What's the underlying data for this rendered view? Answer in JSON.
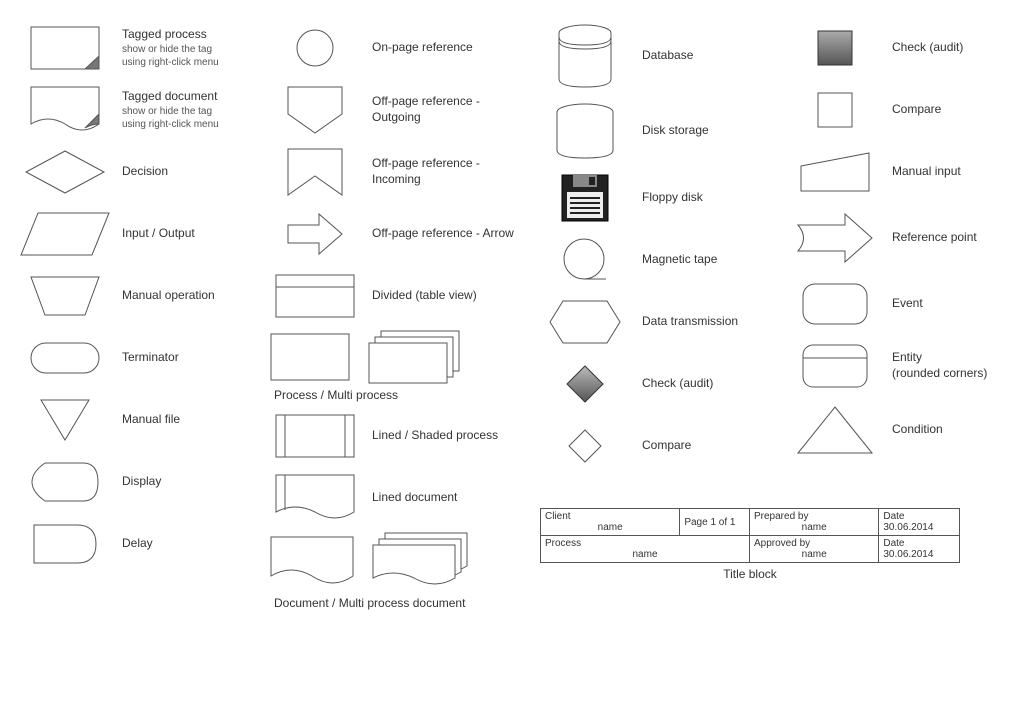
{
  "col1": {
    "tagged_process": {
      "label": "Tagged process",
      "sub1": "show or hide the tag",
      "sub2": "using right-click menu"
    },
    "tagged_document": {
      "label": "Tagged document",
      "sub1": "show or hide the tag",
      "sub2": "using right-click menu"
    },
    "decision": {
      "label": "Decision"
    },
    "input_output": {
      "label": "Input / Output"
    },
    "manual_operation": {
      "label": "Manual operation"
    },
    "terminator": {
      "label": "Terminator"
    },
    "manual_file": {
      "label": "Manual file"
    },
    "display": {
      "label": "Display"
    },
    "delay": {
      "label": "Delay"
    }
  },
  "col2": {
    "onpage": {
      "label": "On-page reference"
    },
    "offpage_out": {
      "label": "Off-page reference - Outgoing"
    },
    "offpage_in": {
      "label": "Off-page reference - Incoming"
    },
    "offpage_arrow": {
      "label": "Off-page reference - Arrow"
    },
    "divided": {
      "label": "Divided (table view)"
    },
    "process_multi": {
      "label": "Process / Multi process"
    },
    "lined_shaded": {
      "label": "Lined / Shaded process"
    },
    "lined_doc": {
      "label": "Lined document"
    },
    "doc_multi": {
      "label": "Document / Multi process document"
    }
  },
  "col3": {
    "database": {
      "label": "Database"
    },
    "disk_storage": {
      "label": "Disk storage"
    },
    "floppy": {
      "label": "Floppy disk"
    },
    "magnetic_tape": {
      "label": "Magnetic tape"
    },
    "data_trans": {
      "label": "Data transmission"
    },
    "check_audit": {
      "label": "Check (audit)"
    },
    "compare": {
      "label": "Compare"
    }
  },
  "col4": {
    "check_audit": {
      "label": "Check (audit)"
    },
    "compare": {
      "label": "Compare"
    },
    "manual_input": {
      "label": "Manual input"
    },
    "reference_point": {
      "label": "Reference point"
    },
    "event": {
      "label": "Event"
    },
    "entity": {
      "label": "Entity",
      "sub": "(rounded corners)"
    },
    "condition": {
      "label": "Condition"
    }
  },
  "title_block": {
    "client_lbl": "Client",
    "client_val": "name",
    "page_lbl": "Page 1  of  1",
    "prepared_lbl": "Prepared by",
    "prepared_val": "name",
    "date_lbl": "Date",
    "date_val": "30.06.2014",
    "process_lbl": "Process",
    "process_val": "name",
    "approved_lbl": "Approved by",
    "approved_val": "name",
    "caption": "Title block"
  }
}
